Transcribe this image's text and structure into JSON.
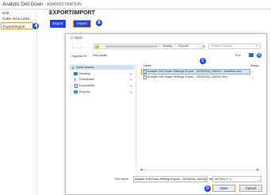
{
  "app": {
    "title": "Analytic Drill Down",
    "section": " - ADMINISTRATION"
  },
  "menu": {
    "items": [
      "Drill",
      "Cube View Links",
      "Export/Import"
    ]
  },
  "page": {
    "title": "EXPORT/IMPORT",
    "export_label": "Export",
    "import_label": "Import"
  },
  "badges": {
    "a": "A",
    "b": "B",
    "c": "C",
    "d": "D"
  },
  "dialog": {
    "title": "Open",
    "path": [
      "Testing",
      "Exports"
    ],
    "search_placeholder": "Search Exports",
    "organize": "Organize ▾",
    "new_folder": "New folder",
    "nav": [
      "Quick access",
      "Desktop",
      "Downloads",
      "Documents",
      "Pictures"
    ],
    "col_name": "Name",
    "col_status": "Status",
    "files": [
      {
        "name": "Analytic Drill Down Settings Export - 20230918_160342 - Modified.xlsx",
        "selected": true
      },
      {
        "name": "Analytic Drill Down Settings Export - 20230918_160342.xlsx",
        "selected": false
      }
    ],
    "filename_label": "File name:",
    "filename_value": "Analytic Drill Down Settings Export - 20230918_160342 - Modifi",
    "filetype_value": "All Files (*.*)",
    "open_label": "Open",
    "cancel_label": "Cancel"
  },
  "colors": {
    "accent": "#1e44e8",
    "highlight": "#e8a23a",
    "ok": "#2e9b3b"
  }
}
